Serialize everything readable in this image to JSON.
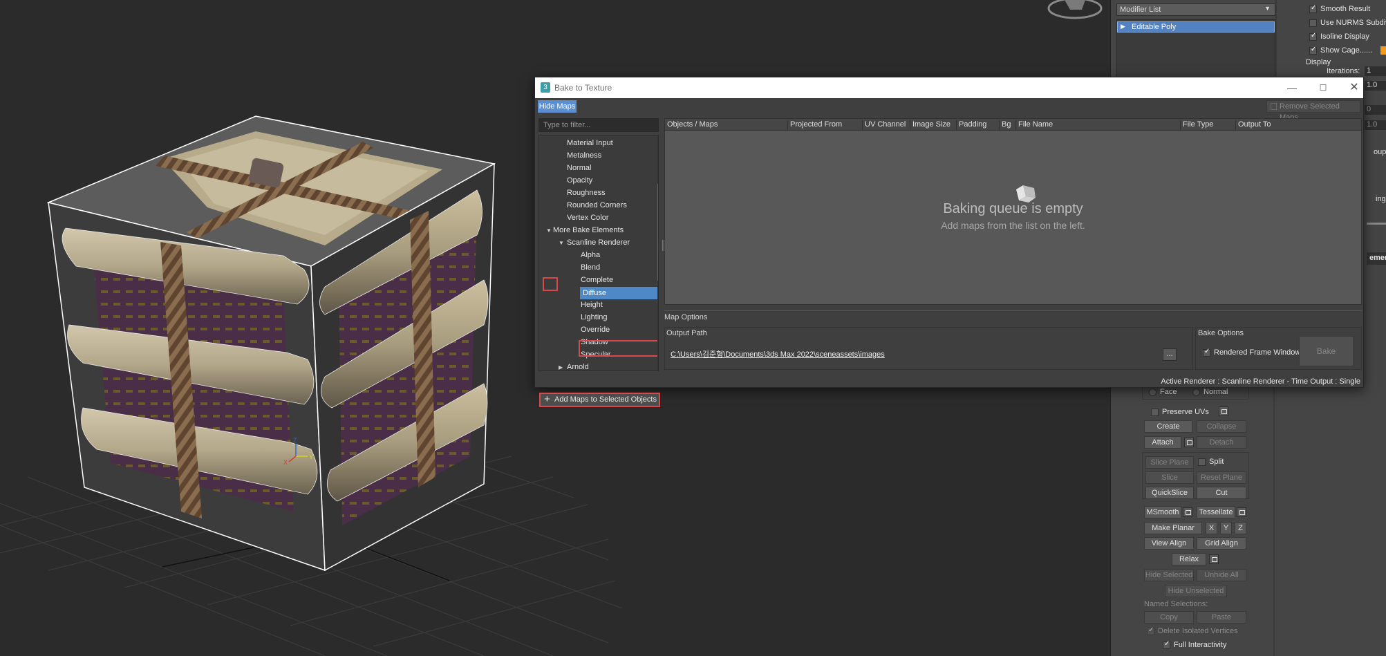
{
  "viewport": {
    "background": "#2b2b2b",
    "gizmo_axis_labels": [
      "X",
      "Y",
      "Z"
    ]
  },
  "command_panel": {
    "modifier_list": "Modifier List",
    "stack_item": "Editable Poly",
    "smooth_result": "Smooth Result",
    "use_nurms": "Use NURMS Subdivis",
    "isoline_display": "Isoline Display",
    "show_cage": "Show Cage......",
    "display_label": "Display",
    "iterations_label": "Iterations:",
    "iterations_value": "1",
    "smoothness_value": "1.0",
    "value_0": "0",
    "value_10": "1.0",
    "partial_oups": "oups",
    "partial_ing": "ing",
    "partial_emen": "emen",
    "face": "Face",
    "normal": "Normal",
    "preserve_uvs": "Preserve UVs",
    "create": "Create",
    "collapse": "Collapse",
    "attach": "Attach",
    "detach": "Detach",
    "slice_plane": "Slice Plane",
    "split": "Split",
    "slice": "Slice",
    "reset_plane": "Reset Plane",
    "quickslice": "QuickSlice",
    "cut": "Cut",
    "msmooth": "MSmooth",
    "tessellate": "Tessellate",
    "make_planar": "Make Planar",
    "x": "X",
    "y": "Y",
    "z": "Z",
    "view_align": "View Align",
    "grid_align": "Grid Align",
    "relax": "Relax",
    "hide_selected": "Hide Selected",
    "unhide_all": "Unhide All",
    "hide_unselected": "Hide Unselected",
    "named_selections": "Named Selections:",
    "copy": "Copy",
    "paste": "Paste",
    "delete_isolated": "Delete Isolated Vertices",
    "full_interactivity": "Full Interactivity",
    "accent_color": "#f29a1c"
  },
  "dialog": {
    "title": "Bake to Texture",
    "hide_maps": "Hide Maps",
    "remove_selected": "Remove Selected Maps",
    "filter_placeholder": "Type to filter...",
    "tree": [
      {
        "label": "Material Input",
        "level": 1
      },
      {
        "label": "Metalness",
        "level": 1
      },
      {
        "label": "Normal",
        "level": 1
      },
      {
        "label": "Opacity",
        "level": 1
      },
      {
        "label": "Roughness",
        "level": 1
      },
      {
        "label": "Rounded Corners",
        "level": 1
      },
      {
        "label": "Vertex Color",
        "level": 1
      },
      {
        "label": "More Bake Elements",
        "level": 0
      },
      {
        "label": "Scanline Renderer",
        "level": 1
      },
      {
        "label": "Alpha",
        "level": 2
      },
      {
        "label": "Blend",
        "level": 2
      },
      {
        "label": "Complete",
        "level": 2
      },
      {
        "label": "Diffuse",
        "level": 2,
        "selected": true
      },
      {
        "label": "Height",
        "level": 2
      },
      {
        "label": "Lighting",
        "level": 2
      },
      {
        "label": "Override",
        "level": 2
      },
      {
        "label": "Shadow",
        "level": 2
      },
      {
        "label": "Specular",
        "level": 2
      },
      {
        "label": "Arnold",
        "level": 1
      }
    ],
    "add_maps": "Add Maps to Selected Objects",
    "columns": [
      "Objects / Maps",
      "Projected From",
      "UV Channel",
      "Image Size",
      "Padding",
      "Bg",
      "File Name",
      "File Type",
      "Output To"
    ],
    "empty_title": "Baking queue is empty",
    "empty_sub": "Add maps from the list on the left.",
    "map_options": "Map Options",
    "output_path_label": "Output Path",
    "output_path": "C:\\Users\\김준형\\Documents\\3ds Max 2022\\sceneassets\\images",
    "browse": "...",
    "bake_options": "Bake Options",
    "rendered_frame_window": "Rendered Frame Window",
    "bake": "Bake",
    "status": "Active Renderer : Scanline Renderer  -  Time Output : Single",
    "highlight_color": "#d84a4a",
    "selection_color": "#4f88c6"
  }
}
